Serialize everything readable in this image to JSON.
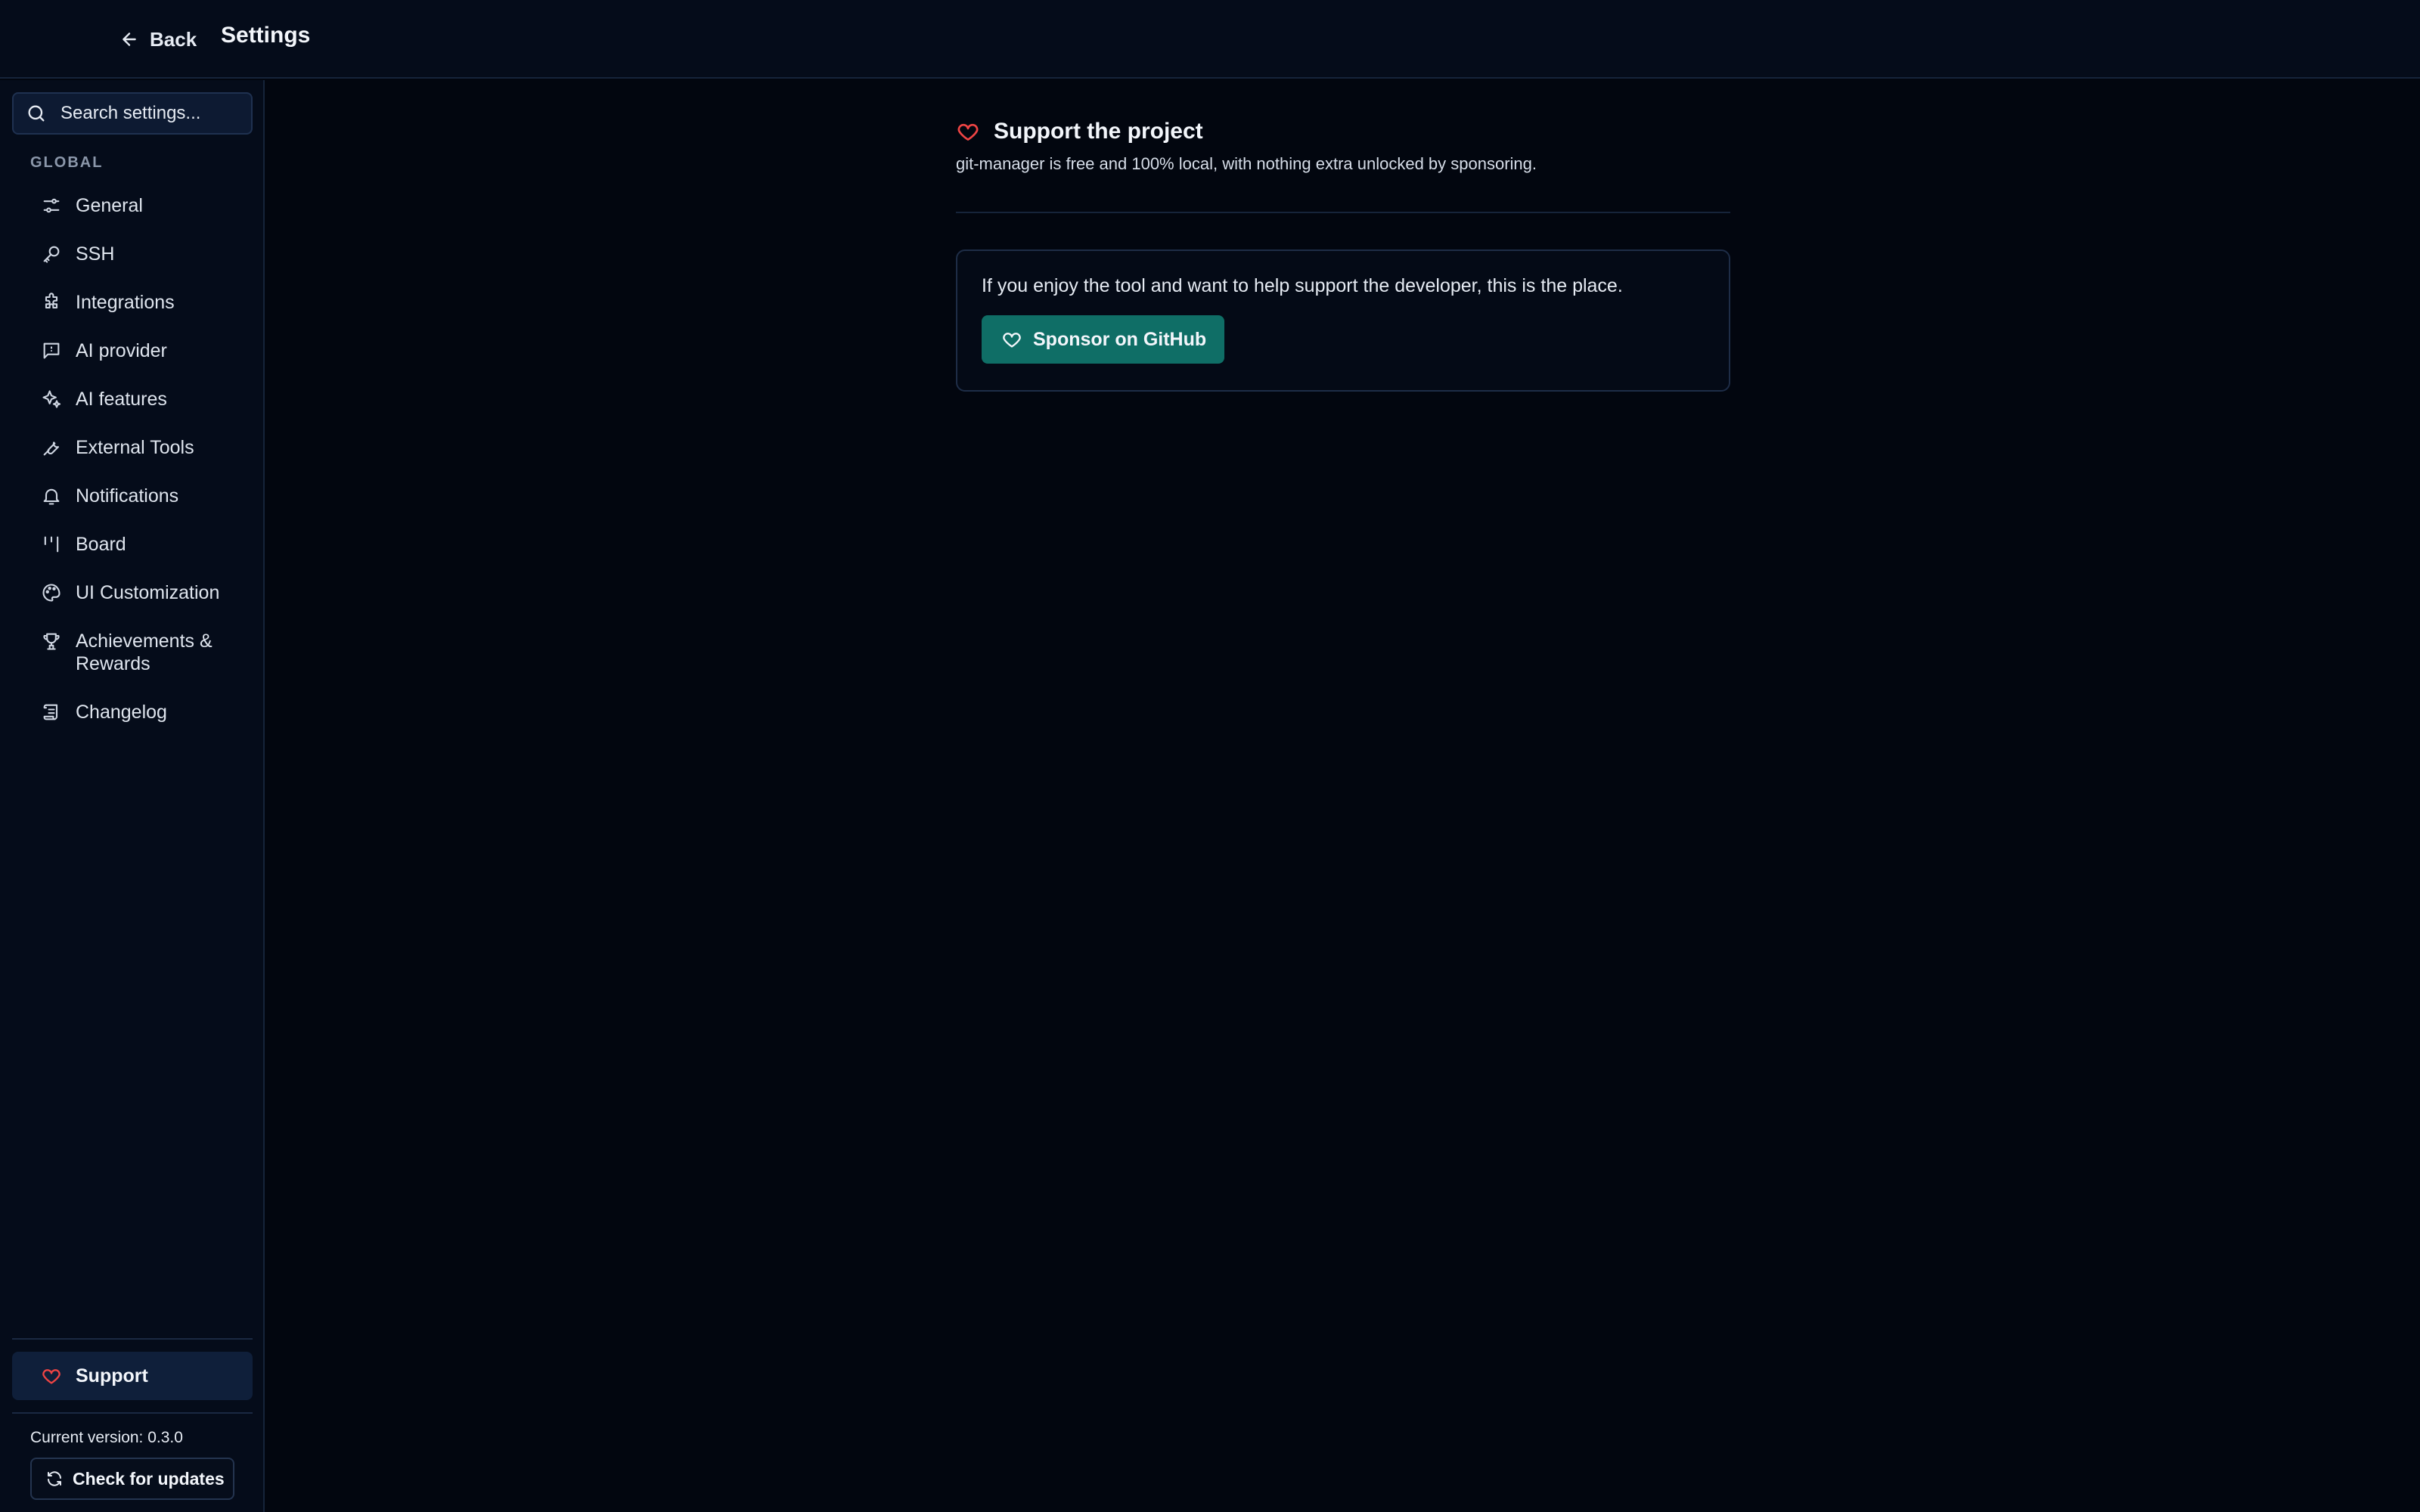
{
  "header": {
    "back_label": "Back",
    "title": "Settings"
  },
  "sidebar": {
    "search_placeholder": "Search settings...",
    "section_label": "GLOBAL",
    "items": [
      {
        "label": "General",
        "icon": "sliders-icon"
      },
      {
        "label": "SSH",
        "icon": "key-icon"
      },
      {
        "label": "Integrations",
        "icon": "puzzle-icon"
      },
      {
        "label": "AI provider",
        "icon": "message-square-icon"
      },
      {
        "label": "AI features",
        "icon": "sparkles-icon"
      },
      {
        "label": "External Tools",
        "icon": "wrench-icon"
      },
      {
        "label": "Notifications",
        "icon": "bell-icon"
      },
      {
        "label": "Board",
        "icon": "kanban-icon"
      },
      {
        "label": "UI Customization",
        "icon": "palette-icon"
      },
      {
        "label": "Achievements & Rewards",
        "icon": "trophy-icon"
      },
      {
        "label": "Changelog",
        "icon": "scroll-icon"
      }
    ],
    "support_label": "Support",
    "version_text": "Current version: 0.3.0",
    "check_updates_label": "Check for updates"
  },
  "main": {
    "section_title": "Support the project",
    "section_description": "git-manager is free and 100% local, with nothing extra unlocked by sponsoring.",
    "card_text": "If you enjoy the tool and want to help support the developer, this is the place.",
    "sponsor_button_label": "Sponsor on GitHub"
  },
  "colors": {
    "background": "#02060f",
    "panel": "#050c1a",
    "accent_teal": "#0f6e66",
    "heart_red": "#ef4444",
    "active_item": "#0f1f3a"
  }
}
